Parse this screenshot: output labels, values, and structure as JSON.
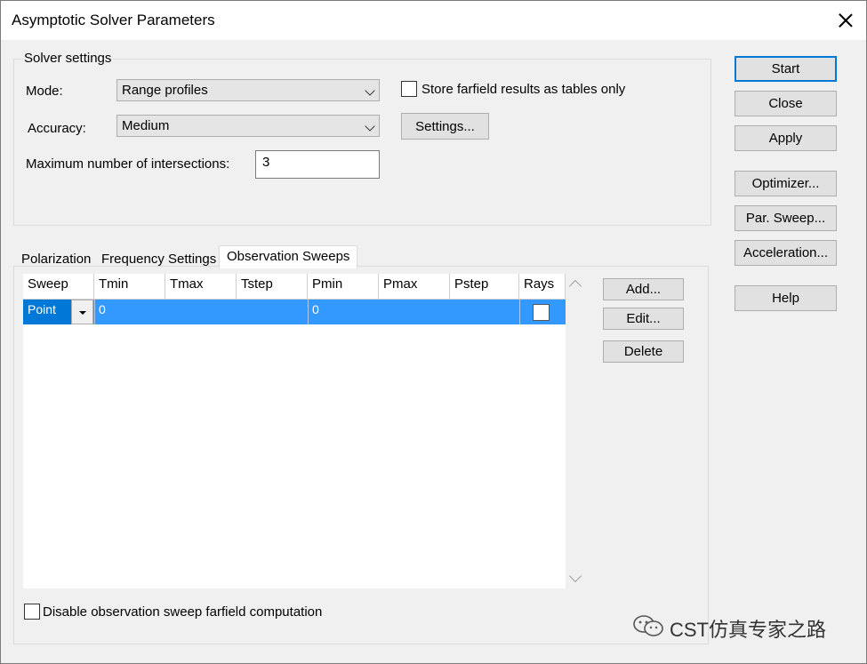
{
  "window": {
    "title": "Asymptotic Solver Parameters"
  },
  "solver_settings": {
    "group_label": "Solver settings",
    "mode_label": "Mode:",
    "mode_value": "Range profiles",
    "accuracy_label": "Accuracy:",
    "accuracy_value": "Medium",
    "max_intersections_label": "Maximum number of intersections:",
    "max_intersections_value": "3",
    "store_farfield_label": "Store farfield results as tables only",
    "store_farfield_checked": false,
    "settings_button": "Settings..."
  },
  "right_buttons": {
    "start": "Start",
    "close": "Close",
    "apply": "Apply",
    "optimizer": "Optimizer...",
    "par_sweep": "Par. Sweep...",
    "acceleration": "Acceleration...",
    "help": "Help"
  },
  "tabs": [
    {
      "label": "Polarization",
      "active": false
    },
    {
      "label": "Frequency Settings",
      "active": false
    },
    {
      "label": "Observation Sweeps",
      "active": true
    }
  ],
  "sweep_table": {
    "columns": [
      "Sweep",
      "Tmin",
      "Tmax",
      "Tstep",
      "Pmin",
      "Pmax",
      "Pstep",
      "Rays"
    ],
    "rows": [
      {
        "Sweep": "Point",
        "Tmin": "0",
        "Tmax": "",
        "Tstep": "",
        "Pmin": "0",
        "Pmax": "",
        "Pstep": "",
        "Rays": false
      }
    ]
  },
  "sweep_buttons": {
    "add": "Add...",
    "edit": "Edit...",
    "delete": "Delete"
  },
  "disable_farfield": {
    "label": "Disable observation sweep farfield computation",
    "checked": false
  },
  "watermark": {
    "text": "CST仿真专家之路"
  },
  "colors": {
    "selection": "#3399ff",
    "default_button_border": "#0078d7",
    "window_bg": "#f0f0f0"
  }
}
